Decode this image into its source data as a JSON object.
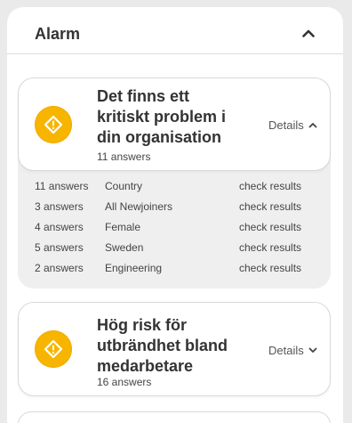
{
  "panel": {
    "title": "Alarm",
    "collapse_icon": "chevron-up-icon"
  },
  "alerts": [
    {
      "title": "Det finns ett kritiskt problem i din organisation",
      "answers": "11 answers",
      "details_label": "Details",
      "details_icon": "chevron-up-icon",
      "expanded": true,
      "icon": "warning-icon",
      "breakdown": [
        {
          "count": "11 answers",
          "group": "Country",
          "link": "check results"
        },
        {
          "count": "3 answers",
          "group": "All Newjoiners",
          "link": "check results"
        },
        {
          "count": "4 answers",
          "group": "Female",
          "link": "check results"
        },
        {
          "count": "5 answers",
          "group": "Sweden",
          "link": "check results"
        },
        {
          "count": "2 answers",
          "group": "Engineering",
          "link": "check results"
        }
      ]
    },
    {
      "title": "Hög risk för utbrändhet bland medarbetare",
      "answers": "16 answers",
      "details_label": "Details",
      "details_icon": "chevron-down-icon",
      "expanded": false,
      "icon": "warning-icon"
    }
  ],
  "colors": {
    "warning": "#f7b500",
    "panel_bg": "#ffffff",
    "page_bg": "#eaeaea",
    "breakdown_bg": "#efefef"
  }
}
